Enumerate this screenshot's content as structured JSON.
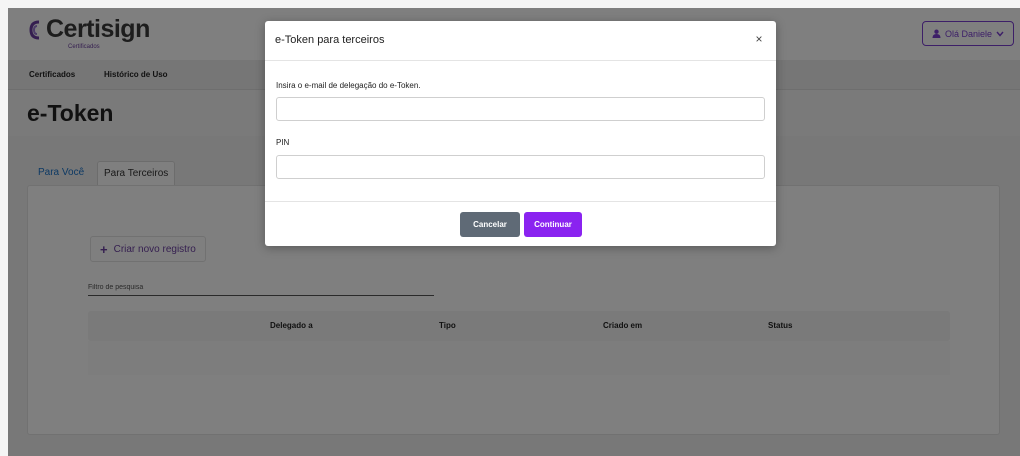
{
  "brand": {
    "name": "Certisign",
    "tagline": "Certificados",
    "accent_color": "#7a3fd0",
    "logo_icon": "certisign-logo-icon"
  },
  "header": {
    "user_menu_label": "Olá Daniele",
    "user_icon": "user-icon",
    "chevron_icon": "chevron-down-icon"
  },
  "nav": {
    "items": [
      {
        "label": "Certificados"
      },
      {
        "label": "Histórico de Uso"
      }
    ]
  },
  "page": {
    "title": "e-Token"
  },
  "tabs": [
    {
      "label": "Para Você",
      "active": true
    },
    {
      "label": "Para Terceiros",
      "active": false
    }
  ],
  "panel": {
    "add_button_label": "Criar novo registro",
    "add_icon": "plus-icon",
    "filter_placeholder": "Filtro de pesquisa",
    "table": {
      "columns": [
        "",
        "Delegado a",
        "Tipo",
        "Criado em",
        "Status"
      ],
      "rows": []
    }
  },
  "modal": {
    "title": "e-Token para terceiros",
    "close_label": "×",
    "email_label": "Insira o e-mail de delegação do e-Token.",
    "email_value": "",
    "pin_label": "PIN",
    "pin_value": "",
    "cancel_label": "Cancelar",
    "continue_label": "Continuar",
    "continue_color": "#8a23f0",
    "cancel_color": "#5f6a76"
  }
}
